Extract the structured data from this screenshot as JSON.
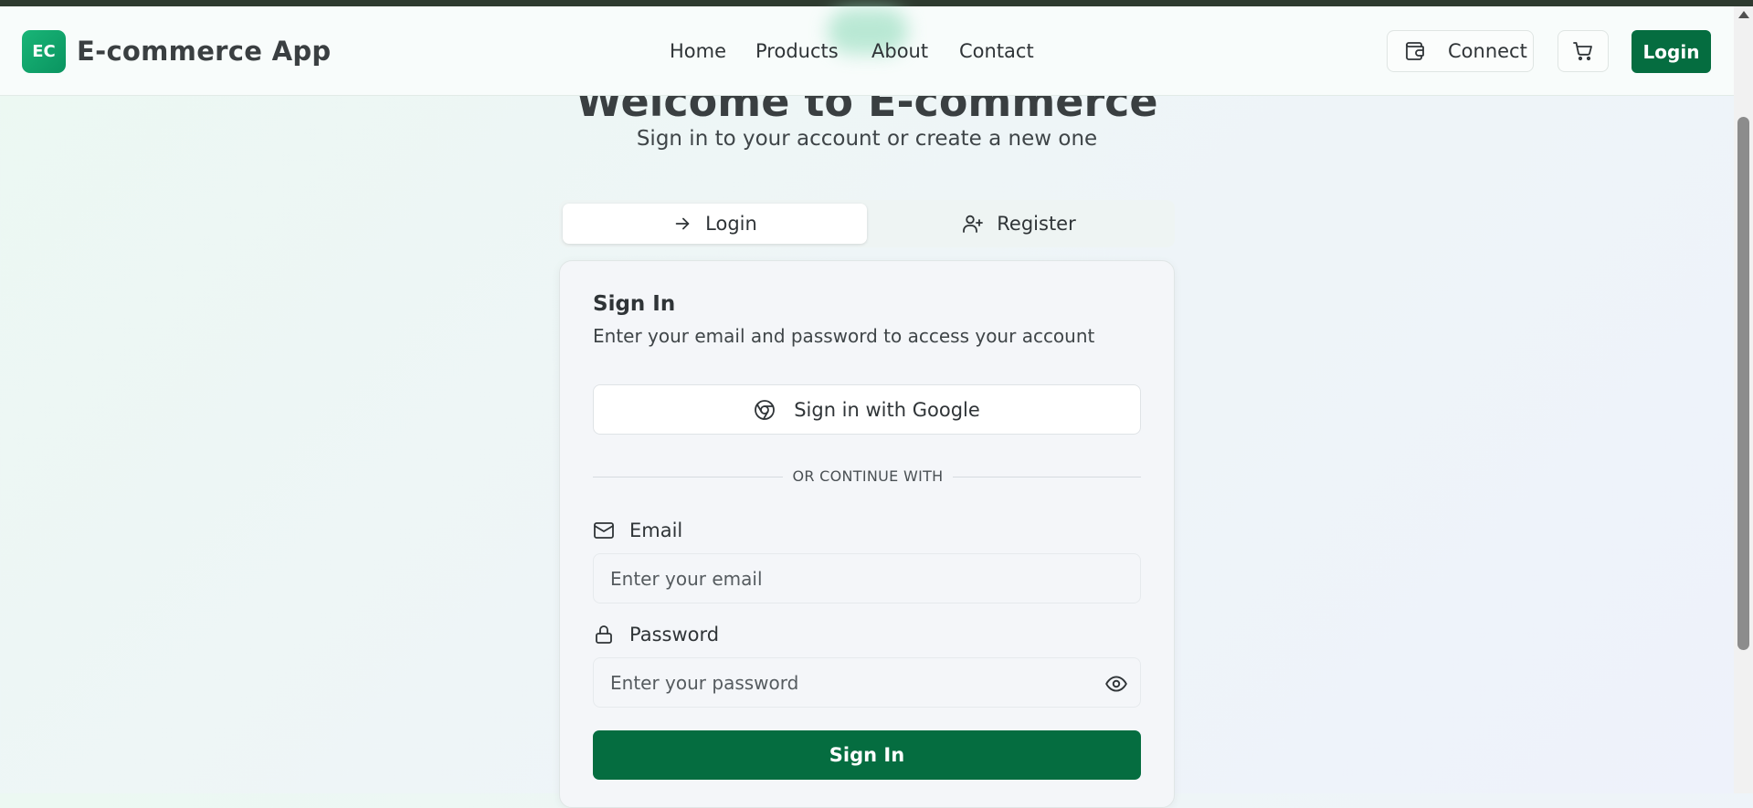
{
  "header": {
    "logo_badge": "EC",
    "app_name": "E-commerce App",
    "nav": [
      "Home",
      "Products",
      "About",
      "Contact"
    ],
    "connect_label": "Connect",
    "login_label": "Login"
  },
  "hero": {
    "title": "Welcome to E-commerce",
    "subtitle": "Sign in to your account or create a new one"
  },
  "tabs": {
    "login": "Login",
    "register": "Register"
  },
  "card": {
    "title": "Sign In",
    "description": "Enter your email and password to access your account",
    "google_button": "Sign in with Google",
    "divider": "OR CONTINUE WITH",
    "email_label": "Email",
    "email_placeholder": "Enter your email",
    "password_label": "Password",
    "password_placeholder": "Enter your password",
    "submit": "Sign In"
  },
  "icons": {
    "wallet": "wallet-icon",
    "cart": "cart-icon",
    "arrow": "arrow-right-icon",
    "user_plus": "user-plus-icon",
    "chrome": "chrome-icon",
    "mail": "mail-icon",
    "lock": "lock-icon",
    "eye": "eye-icon"
  },
  "colors": {
    "primary": "#056d40",
    "logo_gradient_start": "#19b577",
    "logo_gradient_end": "#0a9460"
  }
}
